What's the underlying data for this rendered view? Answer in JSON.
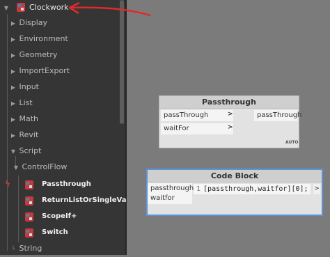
{
  "library": {
    "root": "Clockwork",
    "categories": [
      "Display",
      "Environment",
      "Geometry",
      "ImportExport",
      "Input",
      "List",
      "Math",
      "Revit",
      "Script"
    ],
    "subcategory": "ControlFlow",
    "nodes": [
      "Passthrough",
      "ReturnListOrSingleValue",
      "ScopeIf+",
      "Switch"
    ],
    "last_category": "String"
  },
  "annotation_color": "#e02a2a",
  "passthrough_node": {
    "title": "Passthrough",
    "inputs": [
      "passThrough",
      "waitFor"
    ],
    "output": "passThrough",
    "lacing": "AUTO"
  },
  "code_block": {
    "title": "Code Block",
    "inputs": [
      "passthrough",
      "waitfor"
    ],
    "line_number": "1",
    "code": "[passthrough,waitfor][0];",
    "output_arrow": ">"
  },
  "icons": {
    "package": "package-icon",
    "expanded": "chevron-down-icon",
    "collapsed": "chevron-right-icon",
    "port": "port-arrow-icon",
    "highlight": "lightning-icon"
  }
}
